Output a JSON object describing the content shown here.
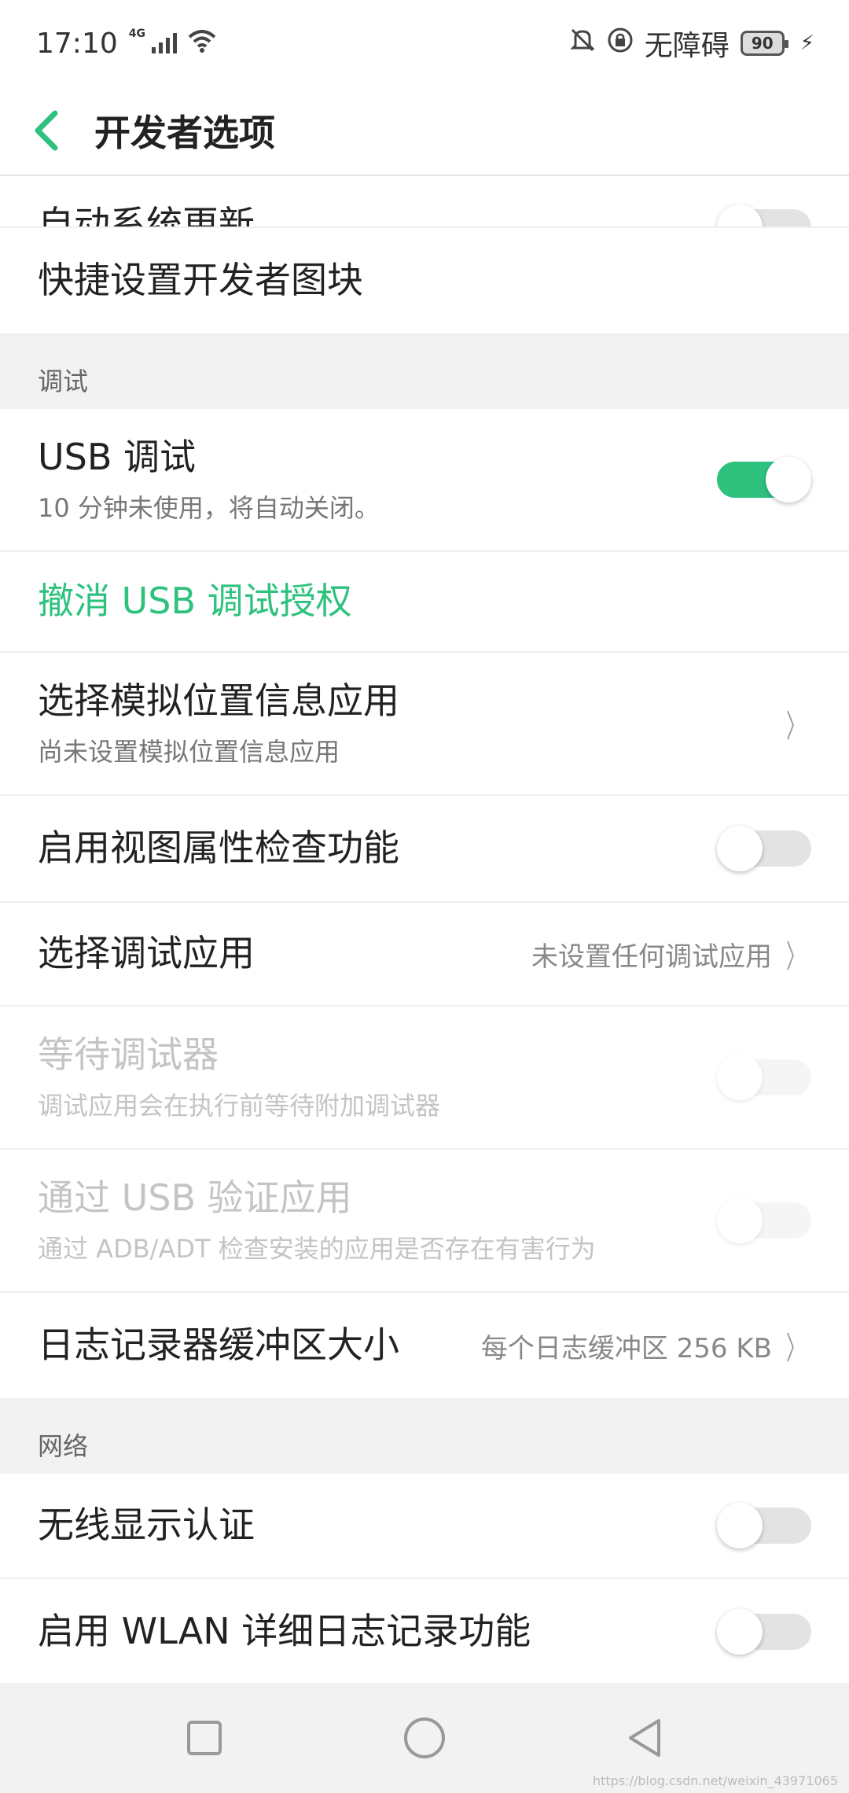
{
  "status_bar": {
    "time": "17:10",
    "network": "4G",
    "accessibility": "无障碍",
    "battery": "90"
  },
  "app_bar": {
    "title": "开发者选项"
  },
  "rows": {
    "auto_update": {
      "title": "自动系统更新"
    },
    "quick_tiles": {
      "title": "快捷设置开发者图块"
    },
    "usb_debug": {
      "title": "USB 调试",
      "subtitle": "10 分钟未使用，将自动关闭。"
    },
    "revoke_usb": {
      "title": "撤消 USB 调试授权"
    },
    "mock_location": {
      "title": "选择模拟位置信息应用",
      "subtitle": "尚未设置模拟位置信息应用"
    },
    "view_attr": {
      "title": "启用视图属性检查功能"
    },
    "debug_app": {
      "title": "选择调试应用",
      "value": "未设置任何调试应用"
    },
    "wait_debugger": {
      "title": "等待调试器",
      "subtitle": "调试应用会在执行前等待附加调试器"
    },
    "verify_usb": {
      "title": "通过 USB 验证应用",
      "subtitle": "通过 ADB/ADT 检查安装的应用是否存在有害行为"
    },
    "log_buffer": {
      "title": "日志记录器缓冲区大小",
      "value": "每个日志缓冲区 256 KB"
    },
    "wireless_display": {
      "title": "无线显示认证"
    },
    "wlan_log": {
      "title": "启用 WLAN 详细日志记录功能"
    }
  },
  "sections": {
    "debug": "调试",
    "network": "网络"
  },
  "toggles": {
    "auto_update": false,
    "usb_debug": true,
    "view_attr": false,
    "wait_debugger": false,
    "verify_usb": false,
    "wireless_display": false,
    "wlan_log": false
  },
  "colors": {
    "accent": "#2ec27e",
    "section_bg": "#f2f2f2"
  },
  "watermark": "https://blog.csdn.net/weixin_43971065"
}
